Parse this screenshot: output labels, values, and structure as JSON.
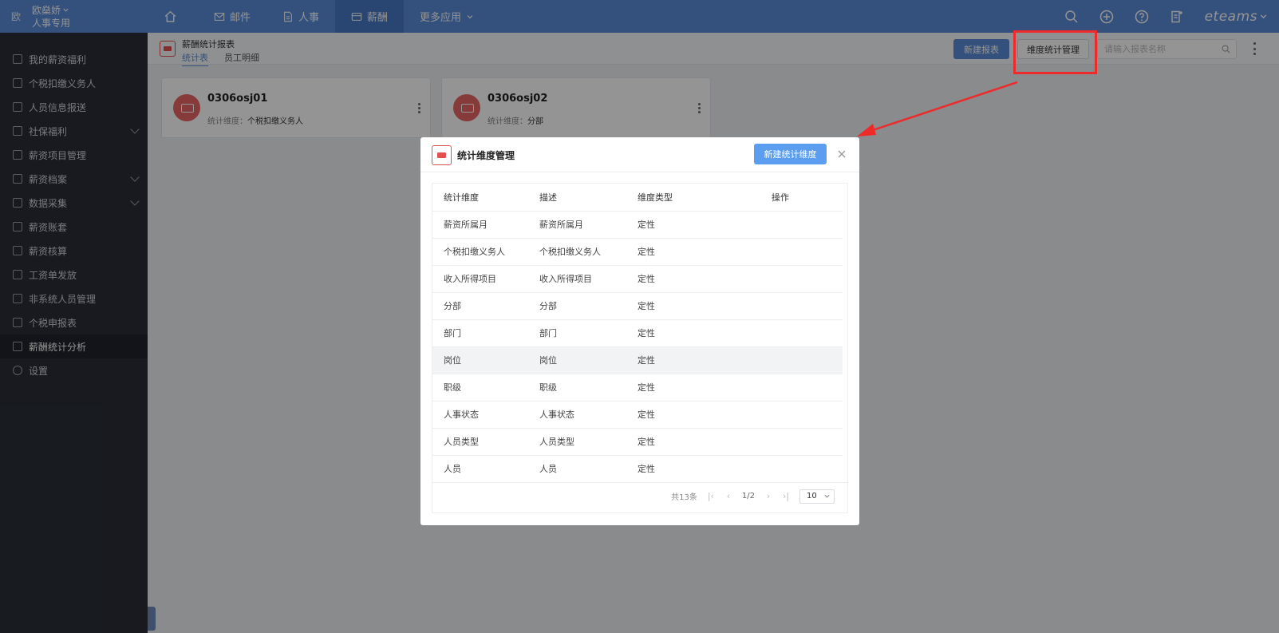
{
  "topbar": {
    "logo": "欧",
    "user_name": "欧燊娇",
    "user_role": "人事专用",
    "nav": [
      {
        "label": ""
      },
      {
        "label": "邮件"
      },
      {
        "label": "人事"
      },
      {
        "label": "薪酬"
      },
      {
        "label": "更多应用"
      }
    ],
    "brand": "eteams"
  },
  "sidebar": {
    "items": [
      {
        "label": "我的薪资福利"
      },
      {
        "label": "个税扣缴义务人"
      },
      {
        "label": "人员信息报送"
      },
      {
        "label": "社保福利"
      },
      {
        "label": "薪资项目管理"
      },
      {
        "label": "薪资档案"
      },
      {
        "label": "数据采集"
      },
      {
        "label": "薪资账套"
      },
      {
        "label": "薪资核算"
      },
      {
        "label": "工资单发放"
      },
      {
        "label": "非系统人员管理"
      },
      {
        "label": "个税申报表"
      },
      {
        "label": "薪酬统计分析"
      },
      {
        "label": "设置"
      }
    ]
  },
  "header": {
    "title": "薪酬统计报表",
    "tabs": [
      "统计表",
      "员工明细"
    ],
    "new_report_label": "新建报表",
    "dimension_manage_label": "维度统计管理",
    "search_placeholder": "请输入报表名称"
  },
  "cards": [
    {
      "title": "0306osj01",
      "dim_label": "统计维度：",
      "dim_value": "个税扣缴义务人"
    },
    {
      "title": "0306osj02",
      "dim_label": "统计维度：",
      "dim_value": "分部"
    }
  ],
  "modal": {
    "title": "统计维度管理",
    "new_button": "新建统计维度",
    "columns": [
      "统计维度",
      "描述",
      "维度类型",
      "操作"
    ],
    "rows": [
      {
        "dimension": "薪资所属月",
        "desc": "薪资所属月",
        "type": "定性"
      },
      {
        "dimension": "个税扣缴义务人",
        "desc": "个税扣缴义务人",
        "type": "定性"
      },
      {
        "dimension": "收入所得项目",
        "desc": "收入所得项目",
        "type": "定性"
      },
      {
        "dimension": "分部",
        "desc": "分部",
        "type": "定性"
      },
      {
        "dimension": "部门",
        "desc": "部门",
        "type": "定性"
      },
      {
        "dimension": "岗位",
        "desc": "岗位",
        "type": "定性"
      },
      {
        "dimension": "职级",
        "desc": "职级",
        "type": "定性"
      },
      {
        "dimension": "人事状态",
        "desc": "人事状态",
        "type": "定性"
      },
      {
        "dimension": "人员类型",
        "desc": "人员类型",
        "type": "定性"
      },
      {
        "dimension": "人员",
        "desc": "人员",
        "type": "定性"
      }
    ],
    "pager": {
      "total": "共13条",
      "page": "1/2",
      "page_size": "10"
    }
  },
  "colors": {
    "topbar": "#5b8bd6",
    "sidebar": "#2a2e36",
    "accent": "#5b8bd6",
    "highlight": "#ee2a2a",
    "icon_red": "#e25050"
  }
}
